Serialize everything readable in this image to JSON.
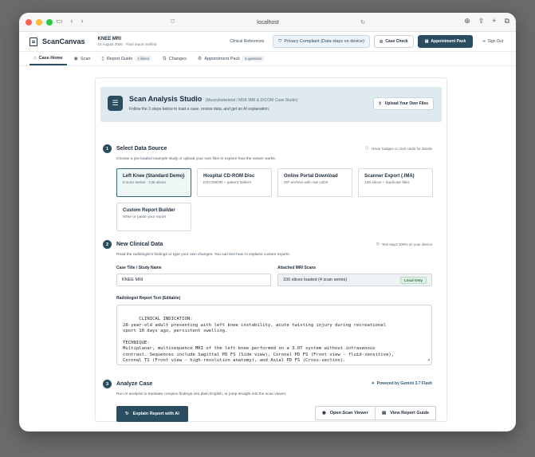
{
  "browser": {
    "url": "localhost"
  },
  "header": {
    "brand": "ScanCanvas",
    "case_title": "KNEE MRI",
    "case_subtitle": "15 August 2026 · Final report verified",
    "clinical_references": "Clinical References",
    "privacy": "Privacy Compliant (Data stays on device)",
    "case_check": "Case Check",
    "appointment_pack": "Appointment Pack",
    "sign_out": "Sign Out"
  },
  "tabs": [
    {
      "label": "Case Home",
      "icon": "home-icon",
      "active": true
    },
    {
      "label": "Scan",
      "icon": "eye-icon"
    },
    {
      "label": "Report Guide",
      "icon": "book-icon",
      "badge": "4 linked"
    },
    {
      "label": "Changes",
      "icon": "changes-icon"
    },
    {
      "label": "Appointment Pack",
      "icon": "gear-icon",
      "badge": "3 questions"
    }
  ],
  "studio": {
    "title": "Scan Analysis Studio",
    "subtitle": "(Musculoskeletal / MSK MRI & DICOM Case Studio)",
    "description": "Follow the 3 steps below to load a case, review data, and get an AI explanation.",
    "upload_label": "Upload Your Own Files"
  },
  "step1": {
    "number": "1",
    "title": "Select Data Source",
    "note": "Hover badges or click cards for details",
    "description": "Choose a pre-loaded example study or upload your own files to explore how the viewer works.",
    "cards": [
      {
        "title": "Left Knee (Standard Demo)",
        "subtitle": "5 scan series · 135 slices",
        "selected": true
      },
      {
        "title": "Hospital CD-ROM Disc",
        "subtitle": "DICOMDIR + patient folders"
      },
      {
        "title": "Online Portal Download",
        "subtitle": "ZIP archive with raw UIDs"
      },
      {
        "title": "Scanner Export (.IMA)",
        "subtitle": "136 slices + duplicate filter"
      },
      {
        "title": "Custom Report Builder",
        "subtitle": "Write or paste your report"
      }
    ]
  },
  "step2": {
    "number": "2",
    "title": "New Clinical Data",
    "note": "Text stays 100% on your device",
    "description": "Read the radiologist's findings or type your own changes. You can test how AI explains custom reports.",
    "case_title_label": "Case Title / Study Name",
    "case_title_value": "KNEE MRI",
    "attached_label": "Attached MRI Scans",
    "attached_value": "100 slices loaded (4 scan series)",
    "local_badge": "Local Only",
    "report_label": "Radiologist Report Text (Editable)",
    "report_text": "CLINICAL INDICATION:\n28-year-old adult presenting with left knee instability, acute twisting injury during recreational\nsport 10 days ago, persistent swelling.\n\nTECHNIQUE:\nMultiplanar, multisequence MRI of the left knee performed on a 3.0T system without intravenous\ncontrast. Sequences include Sagittal PD FS (Side view), Coronal PD FS (Front view - fluid-sensitive),\nCoronal T1 (Front view - high-resolution anatomy), and Axial PD FS (Cross-section)."
  },
  "step3": {
    "number": "3",
    "title": "Analyze Case",
    "description": "Run AI analysis to translate complex findings into plain English, or jump straight into the scan viewer.",
    "powered": "Powered by Gemini 3.7 Flash",
    "explain_label": "Explain Report with AI",
    "open_viewer_label": "Open Scan Viewer",
    "view_guide_label": "View Report Guide"
  },
  "colors": {
    "primary": "#2b4d60",
    "selected_border": "#2e6b78",
    "studio_bg": "#dfeaf0"
  }
}
